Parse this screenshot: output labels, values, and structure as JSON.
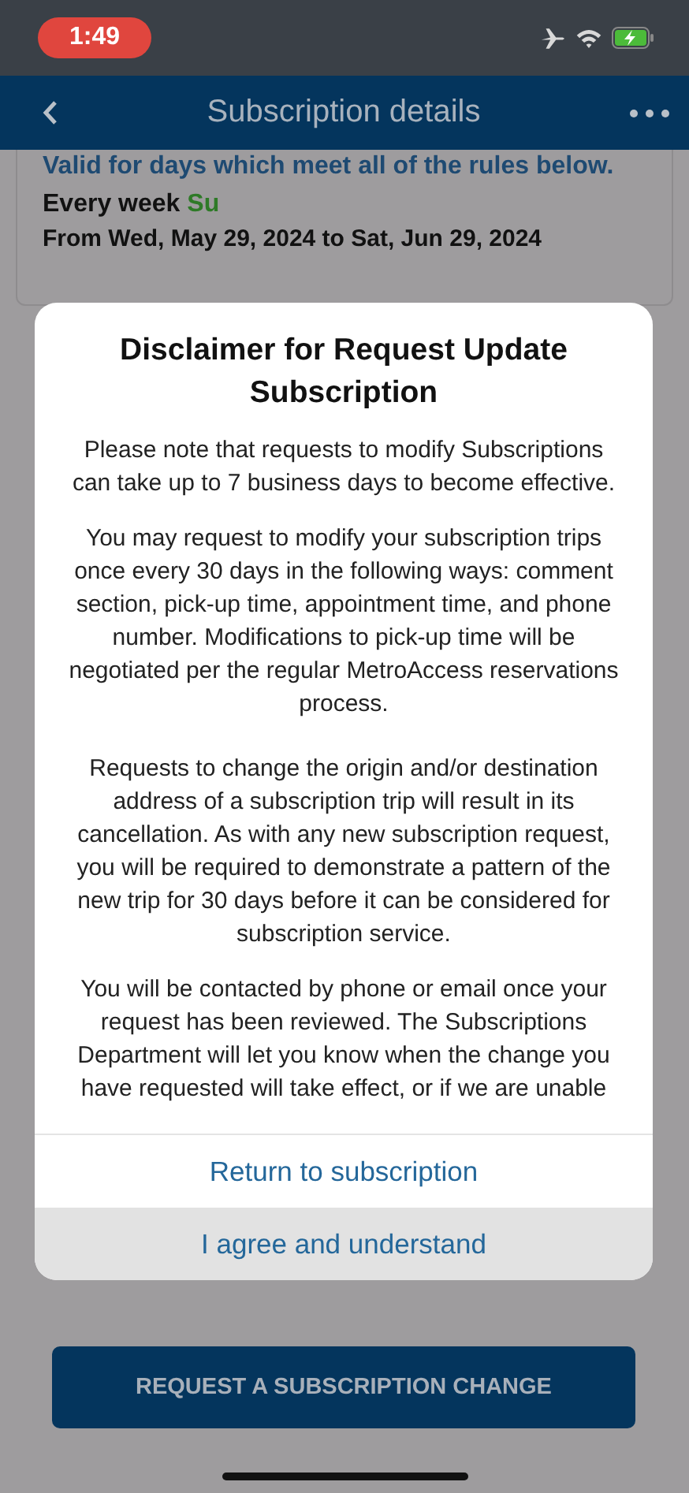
{
  "status_bar": {
    "time": "1:49"
  },
  "nav_bar": {
    "title": "Subscription details"
  },
  "rules_card": {
    "heading": "Valid for days which meet all of the rules below.",
    "schedule_label": "Every week",
    "schedule_days": "Su",
    "date_range": "From Wed, May 29, 2024 to Sat, Jun 29, 2024"
  },
  "dialog": {
    "title": "Disclaimer for Request Update Subscription",
    "paragraphs": [
      "Please note that requests to modify Subscriptions can take up to 7 business days to become effective.",
      "You may request to modify your subscription trips once every 30 days in the following ways: comment section, pick-up time, appointment time, and phone number. Modifications to pick-up time will be negotiated per the regular MetroAccess reservations process.",
      "Requests to change the origin and/or destination address of a subscription trip will result in its cancellation. As with any new subscription request, you will be required to demonstrate a pattern of the new trip for 30 days before it can be considered for subscription service.",
      "You will be contacted by phone or email once your request has been reviewed. The Subscriptions Department will let you know when the change you have requested will take effect, or if we are unable"
    ],
    "buttons": [
      {
        "label": "Return to subscription",
        "pressed": false
      },
      {
        "label": "I agree and understand",
        "pressed": true
      }
    ]
  },
  "request_button": {
    "label": "REQUEST A SUBSCRIPTION CHANGE"
  }
}
